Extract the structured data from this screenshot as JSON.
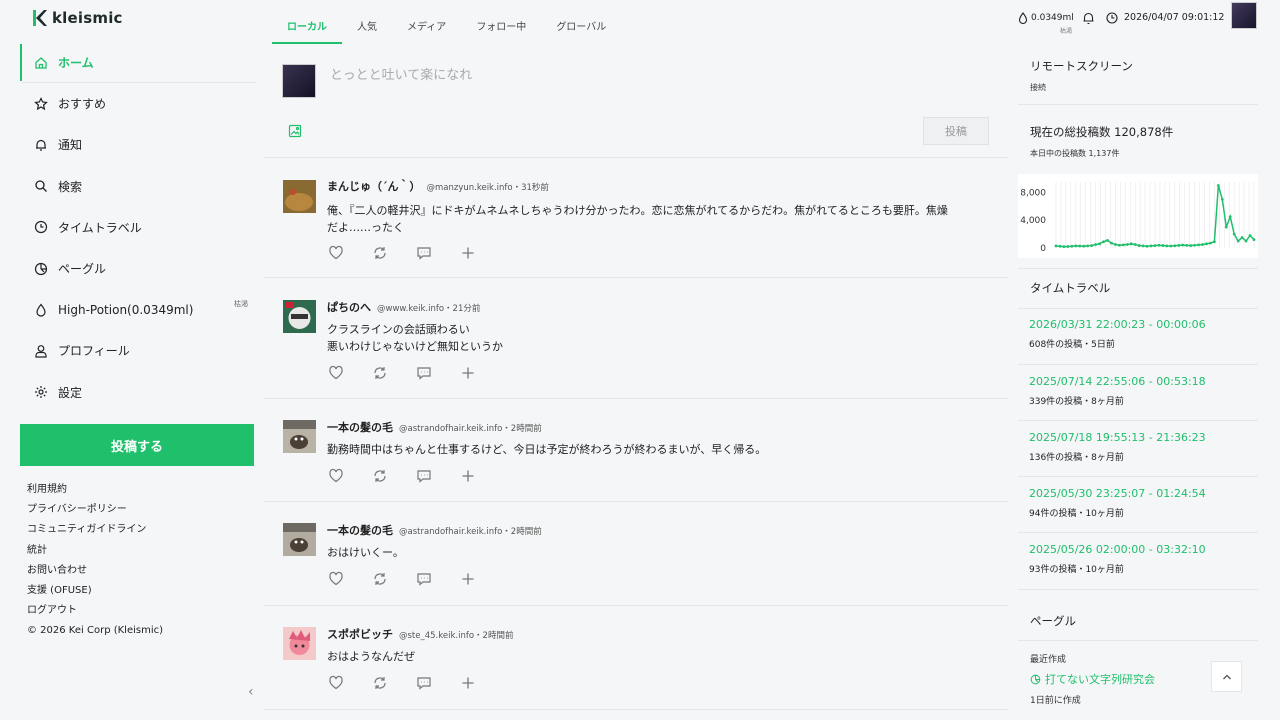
{
  "app": {
    "name": "kleismic"
  },
  "nav": {
    "items": [
      {
        "label": "ホーム",
        "icon": "home-icon"
      },
      {
        "label": "おすすめ",
        "icon": "star-icon"
      },
      {
        "label": "通知",
        "icon": "bell-icon"
      },
      {
        "label": "検索",
        "icon": "search-icon"
      },
      {
        "label": "タイムトラベル",
        "icon": "clock-icon"
      },
      {
        "label": "ペーグル",
        "icon": "pegle-icon"
      },
      {
        "label": "High-Potion(0.0349ml)",
        "icon": "drop-icon",
        "badge": "枯渇"
      },
      {
        "label": "プロフィール",
        "icon": "user-icon"
      },
      {
        "label": "設定",
        "icon": "gear-icon"
      }
    ],
    "post_button": "投稿する"
  },
  "footer": {
    "links": [
      "利用規約",
      "プライバシーポリシー",
      "コミュニティガイドライン",
      "統計",
      "お問い合わせ",
      "支援 (OFUSE)",
      "ログアウト"
    ],
    "copyright": "© 2026 Kei Corp (Kleismic)"
  },
  "tabs": [
    "ローカル",
    "人気",
    "メディア",
    "フォロー中",
    "グローバル"
  ],
  "composer": {
    "placeholder": "とっとと吐いて楽になれ",
    "submit": "投稿"
  },
  "posts": [
    {
      "name": "まんじゅ（´ん｀）",
      "handle": "@manzyun.keik.info・31秒前",
      "lines": [
        "俺、『二人の軽井沢』にドキがムネムネしちゃうわけ分かったわ。恋に恋焦がれてるからだわ。焦がれてるところも要肝。焦燥",
        "だよ……ったく"
      ]
    },
    {
      "name": "ぱちのへ",
      "handle": "@www.keik.info・21分前",
      "lines": [
        "クラスラインの会話頭わるい",
        "悪いわけじゃないけど無知というか"
      ]
    },
    {
      "name": "一本の髪の毛",
      "handle": "@astrandofhair.keik.info・2時間前",
      "lines": [
        "勤務時間中はちゃんと仕事するけど、今日は予定が終わろうが終わるまいが、早く帰る。"
      ]
    },
    {
      "name": "一本の髪の毛",
      "handle": "@astrandofhair.keik.info・2時間前",
      "lines": [
        "おはけいくー。"
      ]
    },
    {
      "name": "スポポビッチ",
      "handle": "@ste_45.keik.info・2時間前",
      "lines": [
        "おはようなんだぜ"
      ]
    }
  ],
  "topbar": {
    "potion": "0.0349ml",
    "potion_status": "枯渇",
    "datetime": "2026/04/07 09:01:12"
  },
  "remote": {
    "title": "リモートスクリーン",
    "status": "接続"
  },
  "stats": {
    "total": "現在の総投稿数 120,878件",
    "today": "本日中の投稿数 1,137件"
  },
  "chart_data": {
    "type": "line",
    "y_ticks": [
      "8,000",
      "4,000",
      "0"
    ],
    "ylim": [
      0,
      9500
    ],
    "values": [
      300,
      250,
      200,
      220,
      250,
      300,
      280,
      260,
      300,
      350,
      500,
      600,
      900,
      1100,
      700,
      500,
      400,
      450,
      500,
      600,
      500,
      350,
      300,
      250,
      300,
      350,
      400,
      350,
      300,
      280,
      320,
      380,
      420,
      380,
      350,
      400,
      450,
      500,
      600,
      700,
      900,
      9000,
      7000,
      3000,
      4500,
      2000,
      1000,
      1500,
      1000,
      1800,
      1200
    ]
  },
  "timetravel": {
    "title": "タイムトラベル",
    "items": [
      {
        "range": "2026/03/31 22:00:23 - 00:00:06",
        "meta": "608件の投稿・5日前"
      },
      {
        "range": "2025/07/14 22:55:06 - 00:53:18",
        "meta": "339件の投稿・8ヶ月前"
      },
      {
        "range": "2025/07/18 19:55:13 - 21:36:23",
        "meta": "136件の投稿・8ヶ月前"
      },
      {
        "range": "2025/05/30 23:25:07 - 01:24:54",
        "meta": "94件の投稿・10ヶ月前"
      },
      {
        "range": "2025/05/26 02:00:00 - 03:32:10",
        "meta": "93件の投稿・10ヶ月前"
      }
    ]
  },
  "pegle": {
    "title": "ペーグル",
    "sub": "最近作成",
    "link": "打てない文字列研究会",
    "meta": "1日前に作成"
  },
  "colors": {
    "accent": "#1fbf6b"
  }
}
